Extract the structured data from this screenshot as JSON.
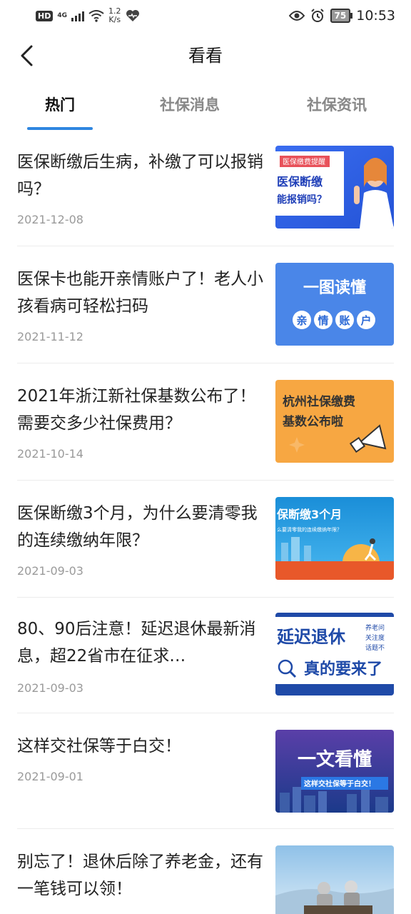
{
  "status_bar": {
    "hd": "HD",
    "network": "4G",
    "speed_value": "1.2",
    "speed_unit": "K/s",
    "battery": "75",
    "time": "10:53",
    "icons": [
      "signal-icon",
      "wifi-icon",
      "heart-icon",
      "eye-icon",
      "alarm-icon",
      "battery-icon"
    ]
  },
  "header": {
    "title": "看看",
    "back_icon": "chevron-left-icon"
  },
  "tabs": [
    {
      "label": "热门",
      "active": true
    },
    {
      "label": "社保消息",
      "active": false
    },
    {
      "label": "社保资讯",
      "active": false
    }
  ],
  "accent_color": "#2f86e0",
  "news": [
    {
      "title": "医保断缴后生病，补缴了可以报销吗？",
      "date": "2021-12-08",
      "thumb": {
        "tag": "医保缴费提醒",
        "line1": "医保断缴",
        "line2": "能报销吗？"
      }
    },
    {
      "title": "医保卡也能开亲情账户了！老人小孩看病可轻松扫码",
      "date": "2021-11-12",
      "thumb": {
        "line1": "一图读懂",
        "chars": [
          "亲",
          "情",
          "账",
          "户"
        ]
      }
    },
    {
      "title": "2021年浙江新社保基数公布了！需要交多少社保费用？",
      "date": "2021-10-14",
      "thumb": {
        "line1": "杭州社保缴费",
        "line2": "基数公布啦"
      }
    },
    {
      "title": "医保断缴3个月，为什么要清零我的连续缴纳年限？",
      "date": "2021-09-03",
      "thumb": {
        "line1": "保断缴3个月",
        "line2": "么要清零我的连续缴纳年限？"
      }
    },
    {
      "title": "80、90后注意！延迟退休最新消息，超22省市在征求…",
      "date": "2021-09-03",
      "thumb": {
        "line1": "延迟退休",
        "line2": "真的要来了",
        "checks": [
          "养老问",
          "关注度",
          "话题不"
        ]
      }
    },
    {
      "title": "这样交社保等于白交！",
      "date": "2021-09-01",
      "thumb": {
        "line1": "一文看懂",
        "line2": "这样交社保等于白交！"
      }
    },
    {
      "title": "别忘了！退休后除了养老金，还有一笔钱可以领！",
      "date": "",
      "thumb": {}
    }
  ]
}
